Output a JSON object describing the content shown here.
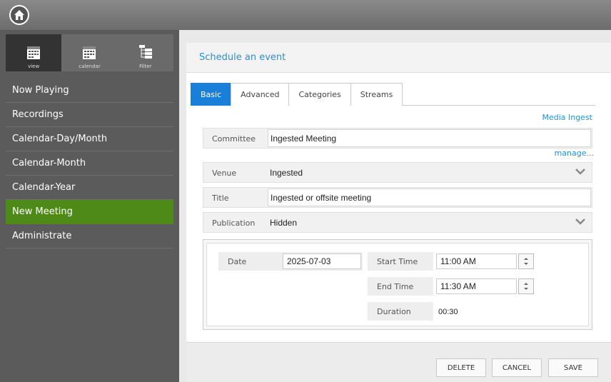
{
  "sidebar": {
    "views": [
      {
        "label": "view",
        "icon": "calendar-grid-icon"
      },
      {
        "label": "calendar",
        "icon": "calendar-grid-icon"
      },
      {
        "label": "Filter",
        "icon": "tree-filter-icon"
      }
    ],
    "items": [
      {
        "label": "Now Playing"
      },
      {
        "label": "Recordings"
      },
      {
        "label": "Calendar-Day/Month"
      },
      {
        "label": "Calendar-Month"
      },
      {
        "label": "Calendar-Year"
      },
      {
        "label": "New Meeting",
        "active": true
      },
      {
        "label": "Administrate"
      }
    ]
  },
  "panel": {
    "title": "Schedule an event",
    "tabs": [
      {
        "label": "Basic",
        "active": true
      },
      {
        "label": "Advanced"
      },
      {
        "label": "Categories"
      },
      {
        "label": "Streams"
      }
    ],
    "media_ingest_link": "Media Ingest",
    "manage_link": "manage...",
    "committee": {
      "label": "Committee",
      "value": "Ingested Meeting"
    },
    "venue": {
      "label": "Venue",
      "value": "Ingested"
    },
    "title_field": {
      "label": "Title",
      "value": "Ingested or offsite meeting"
    },
    "publication": {
      "label": "Publication",
      "value": "Hidden"
    },
    "date": {
      "label": "Date",
      "value": "2025-07-03"
    },
    "start_time": {
      "label": "Start Time",
      "value": "11:00 AM"
    },
    "end_time": {
      "label": "End Time",
      "value": "11:30 AM"
    },
    "duration": {
      "label": "Duration",
      "value": "00:30"
    }
  },
  "footer": {
    "delete_label": "DELETE",
    "cancel_label": "CANCEL",
    "save_label": "SAVE"
  },
  "colors": {
    "accent": "#1a7fd8",
    "link": "#2a8fd0",
    "active_nav": "#4e8a18"
  }
}
